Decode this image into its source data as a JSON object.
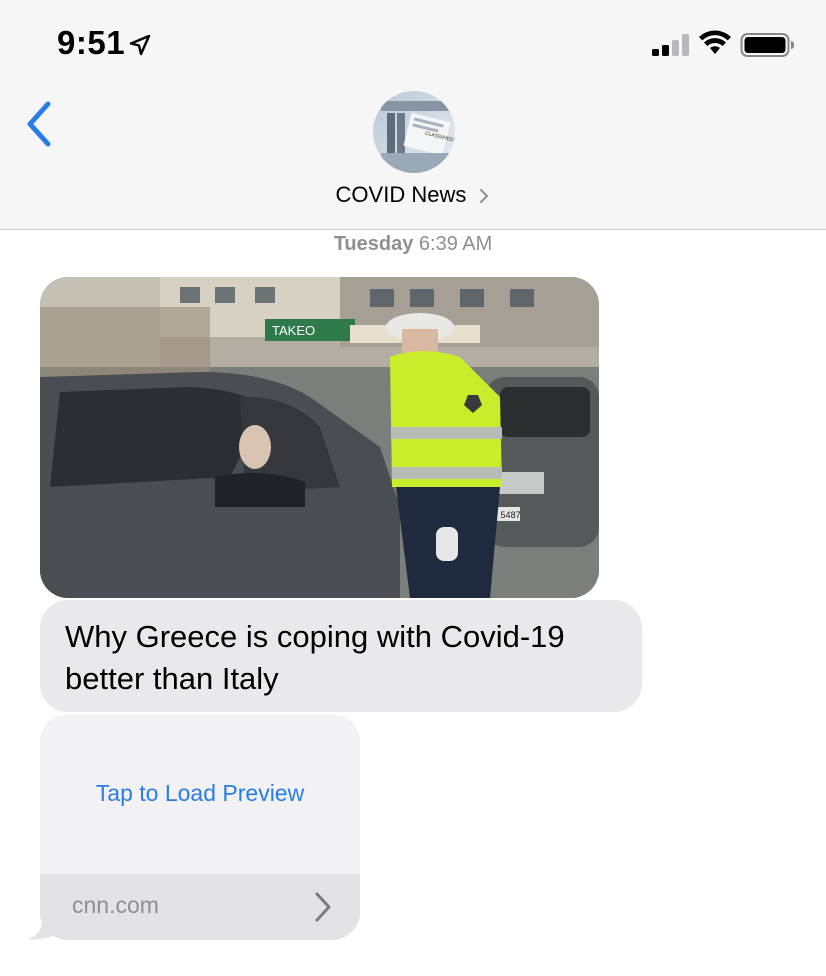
{
  "status_bar": {
    "time": "9:51",
    "location_icon": "location-arrow-icon",
    "signal_icon": "cellular-signal-icon",
    "wifi_icon": "wifi-icon",
    "battery_icon": "battery-icon"
  },
  "header": {
    "back_icon": "chevron-left-icon",
    "contact_name": "COVID News",
    "avatar_text": "CLASSIFIED",
    "accent": "#2a7ce8"
  },
  "thread": {
    "timestamp_day": "Tuesday",
    "timestamp_time": "6:39 AM",
    "link_message": {
      "image_description_icon": "news-photo",
      "title": "Why Greece is coping with Covid-19 better than Italy",
      "image_texts": [
        "TAKEO",
        "ΙΟΥ 5487"
      ]
    },
    "preview_card": {
      "load_text": "Tap to Load Preview",
      "domain": "cnn.com"
    }
  },
  "colors": {
    "bubble_gray": "#e9e9eb",
    "link_blue": "#2a7ce8",
    "secondary_text": "#8e8e93"
  }
}
